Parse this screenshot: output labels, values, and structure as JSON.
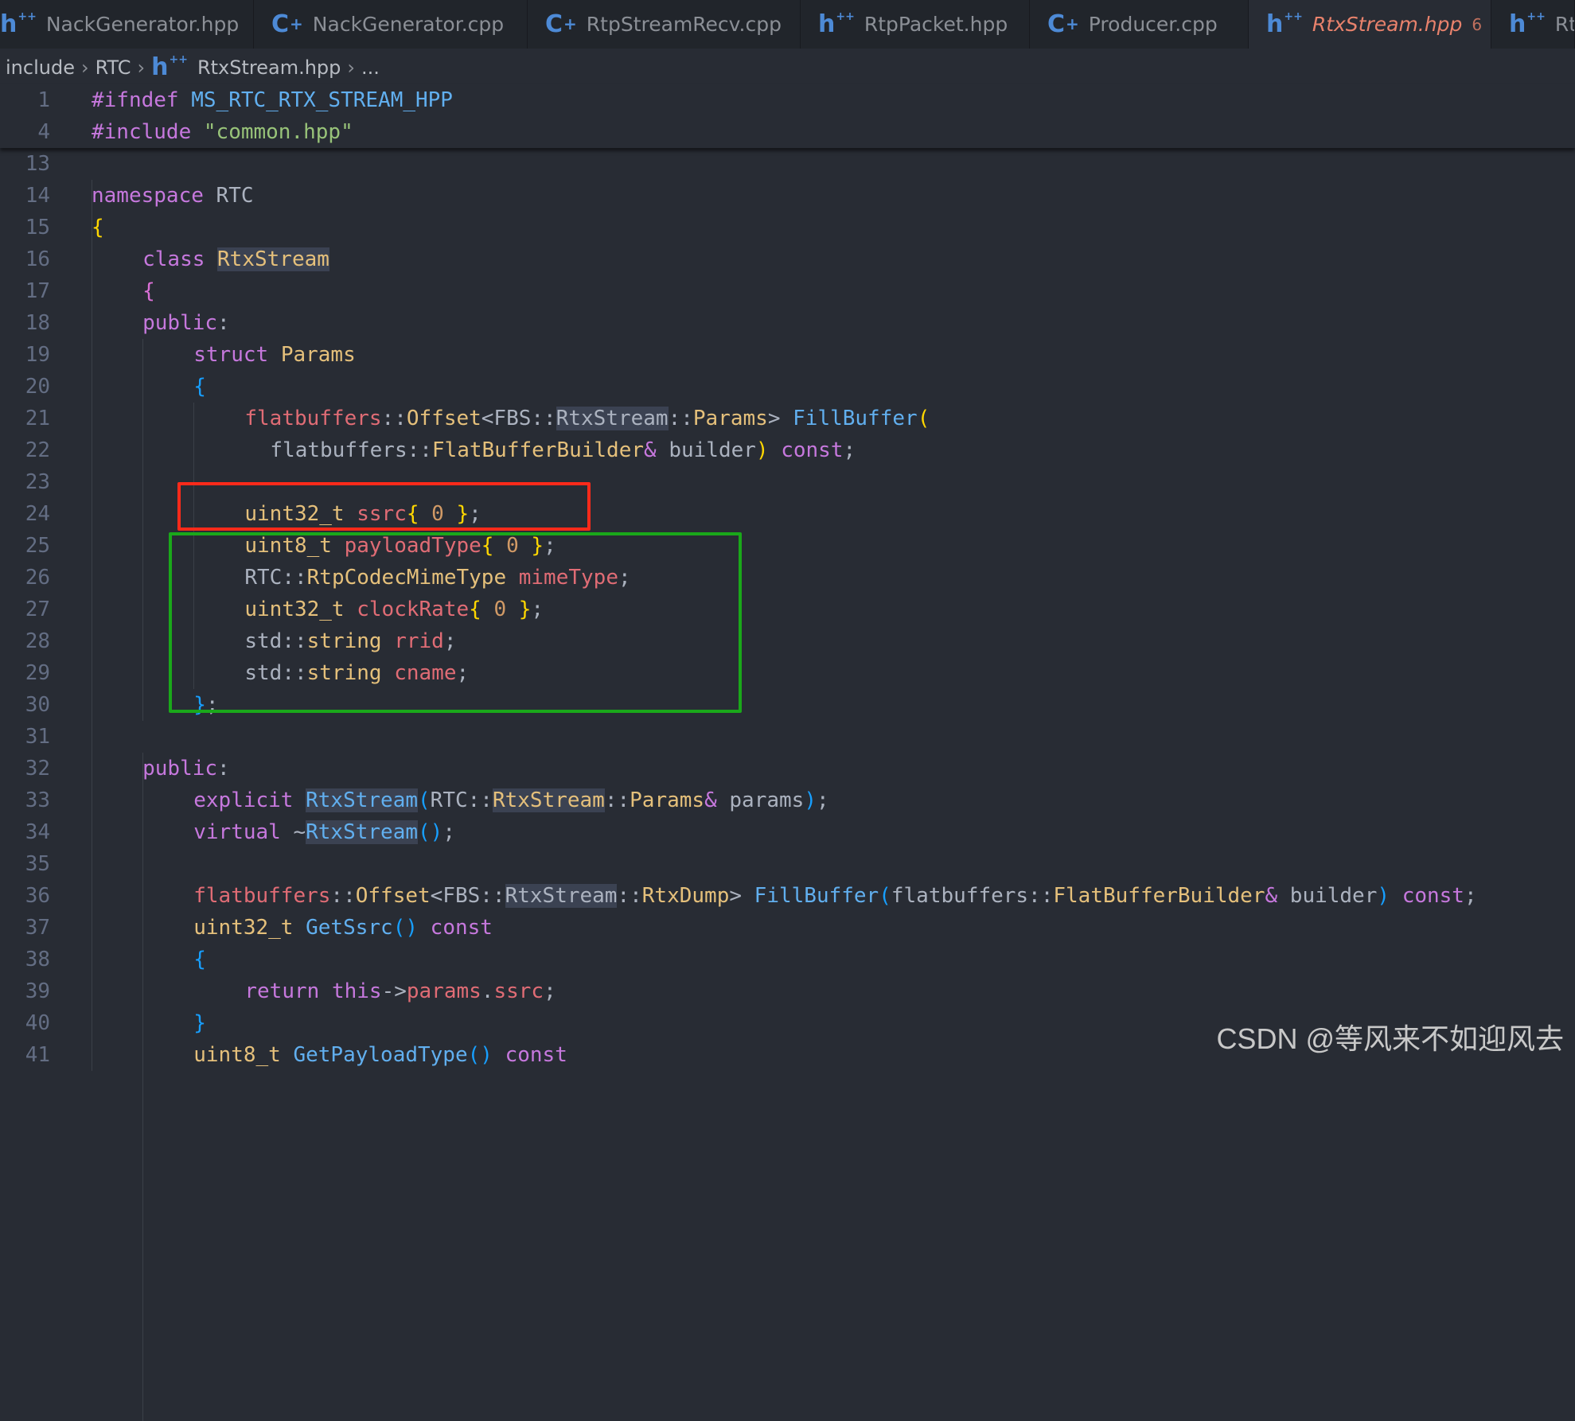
{
  "tabs": [
    {
      "label": "NackGenerator.hpp",
      "icon": "cpp-header-icon",
      "active": false
    },
    {
      "label": "NackGenerator.cpp",
      "icon": "cpp-source-icon",
      "active": false
    },
    {
      "label": "RtpStreamRecv.cpp",
      "icon": "cpp-source-icon",
      "active": false
    },
    {
      "label": "RtpPacket.hpp",
      "icon": "cpp-header-icon",
      "active": false
    },
    {
      "label": "Producer.cpp",
      "icon": "cpp-source-icon",
      "active": false
    },
    {
      "label": "RtxStream.hpp",
      "icon": "cpp-header-icon",
      "active": true,
      "badge": "6",
      "close": "✕"
    },
    {
      "label": "Rtp",
      "icon": "cpp-header-icon",
      "active": false
    }
  ],
  "breadcrumb": [
    "include",
    "RTC",
    "RtxStream.hpp",
    "..."
  ],
  "sticky": [
    {
      "n": "1",
      "indent": 0,
      "t": [
        [
          "pp",
          "#ifndef "
        ],
        [
          "mac",
          "MS_RTC_RTX_STREAM_HPP"
        ]
      ]
    },
    {
      "n": "4",
      "indent": 0,
      "t": [
        [
          "pp",
          "#include "
        ],
        [
          "str",
          "\"common.hpp\""
        ]
      ]
    }
  ],
  "lines": [
    {
      "n": "13",
      "indent": 0,
      "t": []
    },
    {
      "n": "14",
      "indent": 0,
      "t": [
        [
          "kw",
          "namespace"
        ],
        [
          "pl",
          " RTC"
        ]
      ]
    },
    {
      "n": "15",
      "indent": 0,
      "t": [
        [
          "by",
          "{"
        ]
      ]
    },
    {
      "n": "16",
      "indent": 4,
      "t": [
        [
          "kw",
          "class "
        ],
        [
          "ty hl",
          "RtxStream"
        ]
      ]
    },
    {
      "n": "17",
      "indent": 4,
      "t": [
        [
          "bp",
          "{"
        ]
      ]
    },
    {
      "n": "18",
      "indent": 4,
      "t": [
        [
          "kw",
          "public"
        ],
        [
          "pl",
          ":"
        ]
      ]
    },
    {
      "n": "19",
      "indent": 8,
      "t": [
        [
          "kw",
          "struct "
        ],
        [
          "ty",
          "Params"
        ]
      ]
    },
    {
      "n": "20",
      "indent": 8,
      "t": [
        [
          "bb",
          "{"
        ]
      ]
    },
    {
      "n": "21",
      "indent": 12,
      "t": [
        [
          "var",
          "flatbuffers"
        ],
        [
          "pl",
          "::"
        ],
        [
          "ty",
          "Offset"
        ],
        [
          "pl",
          "<FBS::"
        ],
        [
          "pl hl",
          "RtxStream"
        ],
        [
          "pl",
          "::"
        ],
        [
          "ty",
          "Params"
        ],
        [
          "pl",
          "> "
        ],
        [
          "fn",
          "FillBuffer"
        ],
        [
          "by",
          "("
        ]
      ]
    },
    {
      "n": "22",
      "indent": 14,
      "t": [
        [
          "pl",
          "flatbuffers::"
        ],
        [
          "ty",
          "FlatBufferBuilder"
        ],
        [
          "kw",
          "&"
        ],
        [
          "pl",
          " builder"
        ],
        [
          "by",
          ")"
        ],
        [
          "pl",
          " "
        ],
        [
          "kw",
          "const"
        ],
        [
          "pl",
          ";"
        ]
      ]
    },
    {
      "n": "23",
      "indent": 0,
      "t": []
    },
    {
      "n": "24",
      "indent": 12,
      "t": [
        [
          "ty",
          "uint32_t"
        ],
        [
          "pl",
          " "
        ],
        [
          "var",
          "ssrc"
        ],
        [
          "by",
          "{"
        ],
        [
          "num",
          " 0 "
        ],
        [
          "by",
          "}"
        ],
        [
          "pl",
          ";"
        ]
      ]
    },
    {
      "n": "25",
      "indent": 12,
      "t": [
        [
          "ty",
          "uint8_t"
        ],
        [
          "pl",
          " "
        ],
        [
          "var",
          "payloadType"
        ],
        [
          "by",
          "{"
        ],
        [
          "num",
          " 0 "
        ],
        [
          "by",
          "}"
        ],
        [
          "pl",
          ";"
        ]
      ]
    },
    {
      "n": "26",
      "indent": 12,
      "t": [
        [
          "pl",
          "RTC::"
        ],
        [
          "ty",
          "RtpCodecMimeType"
        ],
        [
          "pl",
          " "
        ],
        [
          "var",
          "mimeType"
        ],
        [
          "pl",
          ";"
        ]
      ]
    },
    {
      "n": "27",
      "indent": 12,
      "t": [
        [
          "ty",
          "uint32_t"
        ],
        [
          "pl",
          " "
        ],
        [
          "var",
          "clockRate"
        ],
        [
          "by",
          "{"
        ],
        [
          "num",
          " 0 "
        ],
        [
          "by",
          "}"
        ],
        [
          "pl",
          ";"
        ]
      ]
    },
    {
      "n": "28",
      "indent": 12,
      "t": [
        [
          "pl",
          "std::"
        ],
        [
          "ty",
          "string"
        ],
        [
          "pl",
          " "
        ],
        [
          "var",
          "rrid"
        ],
        [
          "pl",
          ";"
        ]
      ]
    },
    {
      "n": "29",
      "indent": 12,
      "t": [
        [
          "pl",
          "std::"
        ],
        [
          "ty",
          "string"
        ],
        [
          "pl",
          " "
        ],
        [
          "var",
          "cname"
        ],
        [
          "pl",
          ";"
        ]
      ]
    },
    {
      "n": "30",
      "indent": 8,
      "t": [
        [
          "bb",
          "}"
        ],
        [
          "pl",
          ";"
        ]
      ]
    },
    {
      "n": "31",
      "indent": 0,
      "t": []
    },
    {
      "n": "32",
      "indent": 4,
      "t": [
        [
          "kw",
          "public"
        ],
        [
          "pl",
          ":"
        ]
      ]
    },
    {
      "n": "33",
      "indent": 8,
      "t": [
        [
          "kw",
          "explicit "
        ],
        [
          "fn hl",
          "RtxStream"
        ],
        [
          "bb",
          "("
        ],
        [
          "pl",
          "RTC::"
        ],
        [
          "ty hl",
          "RtxStream"
        ],
        [
          "pl",
          "::"
        ],
        [
          "ty",
          "Params"
        ],
        [
          "kw",
          "&"
        ],
        [
          "pl",
          " params"
        ],
        [
          "bb",
          ")"
        ],
        [
          "pl",
          ";"
        ]
      ]
    },
    {
      "n": "34",
      "indent": 8,
      "t": [
        [
          "kw",
          "virtual "
        ],
        [
          "pl",
          "~"
        ],
        [
          "fn hl",
          "RtxStream"
        ],
        [
          "bb",
          "()"
        ],
        [
          "pl",
          ";"
        ]
      ]
    },
    {
      "n": "35",
      "indent": 0,
      "t": []
    },
    {
      "n": "36",
      "indent": 8,
      "t": [
        [
          "var",
          "flatbuffers"
        ],
        [
          "pl",
          "::"
        ],
        [
          "ty",
          "Offset"
        ],
        [
          "pl",
          "<FBS::"
        ],
        [
          "pl hl",
          "RtxStream"
        ],
        [
          "pl",
          "::"
        ],
        [
          "ty",
          "RtxDump"
        ],
        [
          "pl",
          "> "
        ],
        [
          "fn",
          "FillBuffer"
        ],
        [
          "bb",
          "("
        ],
        [
          "pl",
          "flatbuffers::"
        ],
        [
          "ty",
          "FlatBufferBuilder"
        ],
        [
          "kw",
          "&"
        ],
        [
          "pl",
          " builder"
        ],
        [
          "bb",
          ")"
        ],
        [
          "pl",
          " "
        ],
        [
          "kw",
          "const"
        ],
        [
          "pl",
          ";"
        ]
      ]
    },
    {
      "n": "37",
      "indent": 8,
      "t": [
        [
          "ty",
          "uint32_t "
        ],
        [
          "fn",
          "GetSsrc"
        ],
        [
          "bb",
          "()"
        ],
        [
          "pl",
          " "
        ],
        [
          "kw",
          "const"
        ]
      ]
    },
    {
      "n": "38",
      "indent": 8,
      "t": [
        [
          "bb",
          "{"
        ]
      ]
    },
    {
      "n": "39",
      "indent": 12,
      "t": [
        [
          "kw",
          "return "
        ],
        [
          "kw",
          "this"
        ],
        [
          "pl",
          "->"
        ],
        [
          "var",
          "params"
        ],
        [
          "pl",
          "."
        ],
        [
          "var",
          "ssrc"
        ],
        [
          "pl",
          ";"
        ]
      ]
    },
    {
      "n": "40",
      "indent": 8,
      "t": [
        [
          "bb",
          "}"
        ]
      ]
    },
    {
      "n": "41",
      "indent": 8,
      "t": [
        [
          "ty",
          "uint8_t "
        ],
        [
          "fn",
          "GetPayloadType"
        ],
        [
          "bb",
          "()"
        ],
        [
          "pl",
          " "
        ],
        [
          "kw",
          "const"
        ]
      ]
    }
  ],
  "annotations": {
    "red_box": "#ff2a1a",
    "green_box": "#1aa81a"
  },
  "watermark": "CSDN @等风来不如迎风去"
}
